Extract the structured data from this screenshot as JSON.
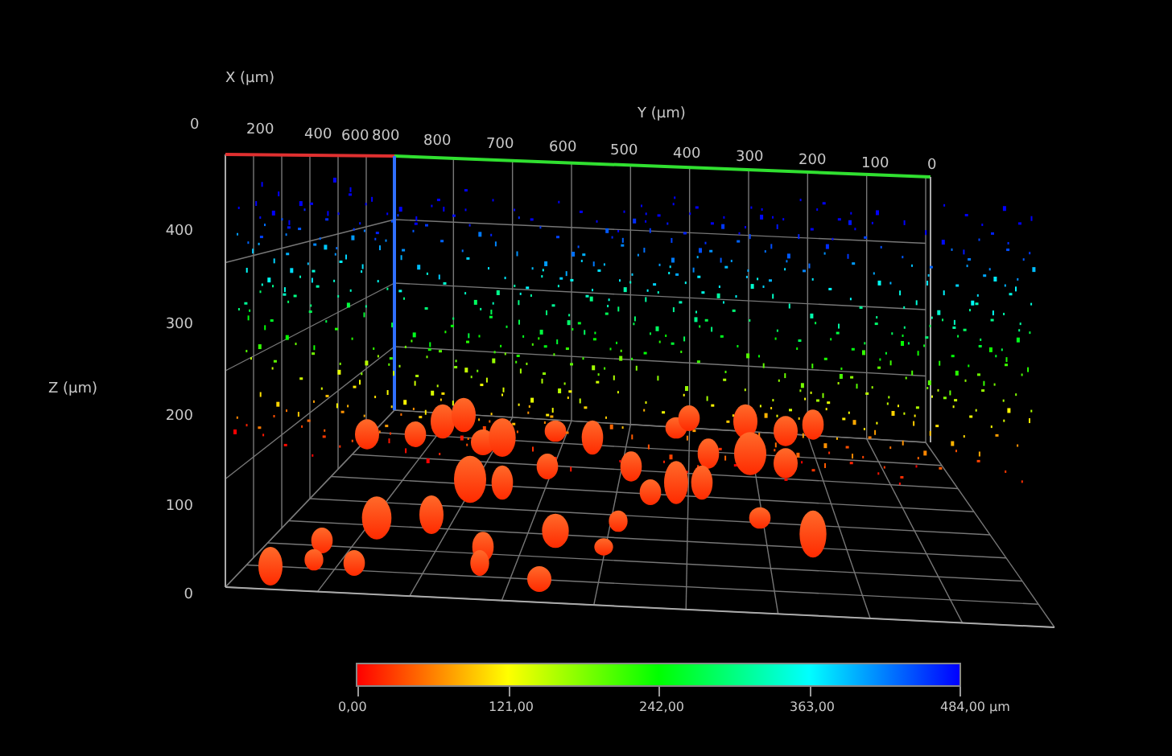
{
  "axes": {
    "x": {
      "title": "X (µm)",
      "ticks": [
        "0",
        "200",
        "400",
        "600",
        "800"
      ]
    },
    "y": {
      "title": "Y (µm)",
      "ticks": [
        "800",
        "700",
        "600",
        "500",
        "400",
        "300",
        "200",
        "100",
        "0"
      ]
    },
    "z": {
      "title": "Z (µm)",
      "ticks": [
        "400",
        "300",
        "200",
        "100",
        "0"
      ]
    }
  },
  "color_bar": {
    "labels": [
      "0,00",
      "121,00",
      "242,00",
      "363,00",
      "484,00 µm"
    ]
  }
}
